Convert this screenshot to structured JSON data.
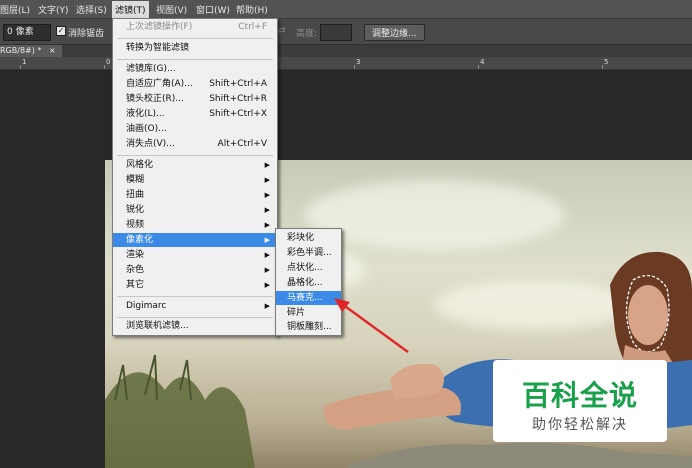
{
  "menubar": {
    "items": [
      "图层(L)",
      "文字(Y)",
      "选择(S)",
      "滤镜(T)",
      "视图(V)",
      "窗口(W)",
      "帮助(H)"
    ],
    "active": "滤镜(T)"
  },
  "options": {
    "feather_value": "0 像素",
    "anti_alias_label": "消除锯齿",
    "height_label": "高度:",
    "refine_edge_label": "调整边缘..."
  },
  "document_tab": {
    "label": "RGB/8#) *",
    "close": "×"
  },
  "ruler": {
    "numbers": [
      "1",
      "0",
      "3",
      "4",
      "5"
    ]
  },
  "filter_menu": {
    "items": [
      {
        "label": "上次滤镜操作(F)",
        "shortcut": "Ctrl+F",
        "disabled": true
      },
      {
        "label": "转换为智能滤镜"
      },
      {
        "label": "滤镜库(G)..."
      },
      {
        "label": "自适应广角(A)...",
        "shortcut": "Shift+Ctrl+A"
      },
      {
        "label": "镜头校正(R)...",
        "shortcut": "Shift+Ctrl+R"
      },
      {
        "label": "液化(L)...",
        "shortcut": "Shift+Ctrl+X"
      },
      {
        "label": "油画(O)..."
      },
      {
        "label": "消失点(V)...",
        "shortcut": "Alt+Ctrl+V"
      },
      {
        "label": "风格化"
      },
      {
        "label": "模糊"
      },
      {
        "label": "扭曲"
      },
      {
        "label": "锐化"
      },
      {
        "label": "视频"
      },
      {
        "label": "像素化",
        "highlighted": true
      },
      {
        "label": "渲染"
      },
      {
        "label": "杂色"
      },
      {
        "label": "其它"
      },
      {
        "label": "Digimarc"
      },
      {
        "label": "浏览联机滤镜..."
      }
    ],
    "submenu_arrow": "▶"
  },
  "pixelate_submenu": {
    "items": [
      {
        "label": "彩块化"
      },
      {
        "label": "彩色半调..."
      },
      {
        "label": "点状化..."
      },
      {
        "label": "晶格化..."
      },
      {
        "label": "马赛克...",
        "highlighted": true
      },
      {
        "label": "碎片"
      },
      {
        "label": "铜板雕刻..."
      }
    ]
  },
  "watermark": {
    "title": "百科全说",
    "subtitle": "助你轻松解决"
  },
  "colors": {
    "highlight": "#3b8ae8",
    "annotation_arrow": "#e02626",
    "watermark_green": "#1aa04a"
  }
}
